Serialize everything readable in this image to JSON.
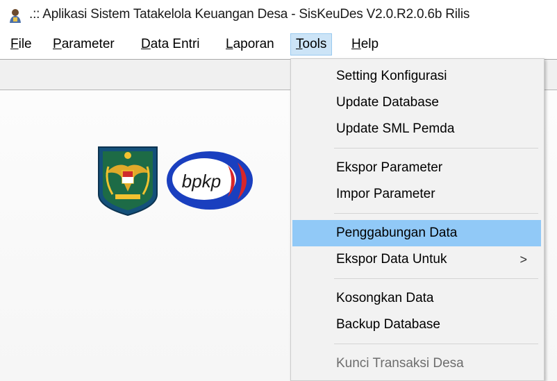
{
  "window": {
    "title": ".:: Aplikasi Sistem Tatakelola Keuangan Desa - SisKeuDes V2.0.R2.0.6b Rilis",
    "app_icon": "siskeudes-app-icon"
  },
  "menubar": {
    "items": [
      {
        "pre": "",
        "u": "F",
        "post": "ile"
      },
      {
        "pre": "",
        "u": "P",
        "post": "arameter"
      },
      {
        "pre": "",
        "u": "D",
        "post": "ata Entri"
      },
      {
        "pre": "",
        "u": "L",
        "post": "aporan"
      },
      {
        "pre": "",
        "u": "T",
        "post": "ools"
      },
      {
        "pre": "",
        "u": "H",
        "post": "elp"
      }
    ],
    "active": "Tools"
  },
  "logos": {
    "emblem": "garuda-emblem-icon",
    "bpkp_text": "bpkp"
  },
  "tools_menu": {
    "items": [
      {
        "label": "Setting Konfigurasi"
      },
      {
        "label": "Update Database"
      },
      {
        "label": "Update SML Pemda"
      },
      {
        "label": "Ekspor Parameter"
      },
      {
        "label": "Impor Parameter"
      },
      {
        "label": "Penggabungan Data",
        "highlighted": true
      },
      {
        "label": "Ekspor Data Untuk",
        "submenu_arrow": ">"
      },
      {
        "label": "Kosongkan Data"
      },
      {
        "label": "Backup Database"
      },
      {
        "label": "Kunci Transaksi Desa",
        "disabled": true
      }
    ]
  },
  "colors": {
    "highlight": "#91c9f7",
    "active_menu": "#cce4f7",
    "bpkp_blue": "#1a3fbf",
    "bpkp_red": "#d8262a"
  }
}
